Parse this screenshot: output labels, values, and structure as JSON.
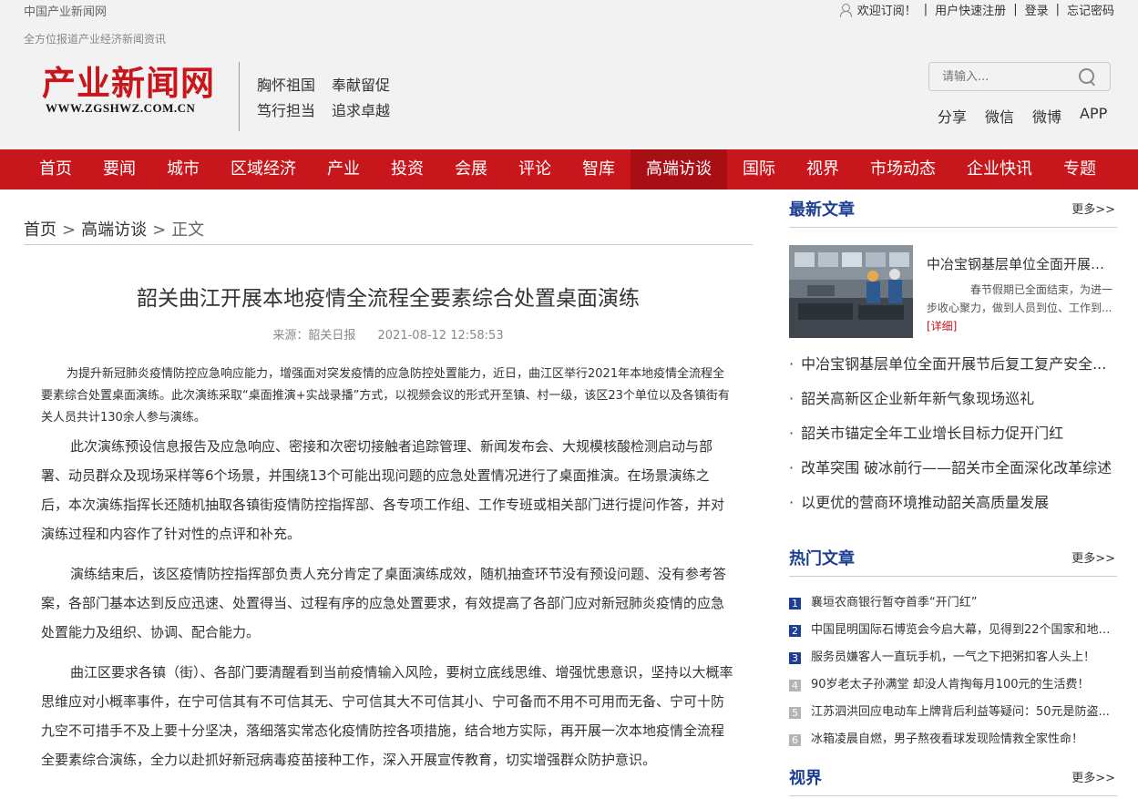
{
  "topbar": {
    "site_name": "中国产业新闻网",
    "subscribe": "欢迎订阅！",
    "register": "用户快速注册",
    "login": "登录",
    "forgot": "忘记密码"
  },
  "header": {
    "tagline": "全方位报道产业经济新闻资讯",
    "logo_cn": "产业新闻网",
    "logo_en": "WWW.ZGSHWZ.COM.CN",
    "slogan": [
      "胸怀祖国",
      "奉献留促",
      "笃行担当",
      "追求卓越"
    ],
    "search_placeholder": "请输入...",
    "share_links": [
      "分享",
      "微信",
      "微博",
      "APP"
    ]
  },
  "nav": {
    "items": [
      "首页",
      "要闻",
      "城市",
      "区域经济",
      "产业",
      "投资",
      "会展",
      "评论",
      "智库",
      "高端访谈",
      "国际",
      "视界",
      "市场动态",
      "企业快讯",
      "专题"
    ],
    "active": "高端访谈"
  },
  "breadcrumb": {
    "home": "首页",
    "section": "高端访谈",
    "current": "正文"
  },
  "article": {
    "title": "韶关曲江开展本地疫情全流程全要素综合处置桌面演练",
    "source": "来源：韶关日报",
    "datetime": "2021-08-12 12:58:53",
    "lead": "为提升新冠肺炎疫情防控应急响应能力，增强面对突发疫情的应急防控处置能力，近日，曲江区举行2021年本地疫情全流程全要素综合处置桌面演练。此次演练采取“桌面推演+实战录播”方式，以视频会议的形式开至镇、村一级，该区23个单位以及各镇街有关人员共计130余人参与演练。",
    "paragraphs": [
      "此次演练预设信息报告及应急响应、密接和次密切接触者追踪管理、新闻发布会、大规模核酸检测启动与部署、动员群众及现场采样等6个场景，并围绕13个可能出现问题的应急处置情况进行了桌面推演。在场景演练之后，本次演练指挥长还随机抽取各镇街疫情防控指挥部、各专项工作组、工作专班或相关部门进行提问作答，并对演练过程和内容作了针对性的点评和补充。",
      "演练结束后，该区疫情防控指挥部负责人充分肯定了桌面演练成效，随机抽查环节没有预设问题、没有参考答案，各部门基本达到反应迅速、处置得当、过程有序的应急处置要求，有效提高了各部门应对新冠肺炎疫情的应急处置能力及组织、协调、配合能力。",
      "曲江区要求各镇（街）、各部门要清醒看到当前疫情输入风险，要树立底线思维、增强忧患意识，坚持以大概率思维应对小概率事件，在宁可信其有不可信其无、宁可信其大不可信其小、宁可备而不用不可用而无备、宁可十防九空不可措手不及上要十分坚决，落细落实常态化疫情防控各项措施，结合地方实际，再开展一次本地疫情全流程全要素综合演练，全力以赴抓好新冠病毒疫苗接种工作，深入开展宣传教育，切实增强群众防护意识。"
    ]
  },
  "sidebar": {
    "latest": {
      "title": "最新文章",
      "more": "更多>>",
      "featured": {
        "title": "中冶宝钢基层单位全面开展节后复工复产安全...",
        "summary": "春节假期已全面结束，为进一步收心聚力，做到人员到位、工作到...",
        "detail": "[详细]"
      },
      "items": [
        "中冶宝钢基层单位全面开展节后复工复产安全...",
        "韶关高新区企业新年新气象现场巡礼",
        "韶关市锚定全年工业增长目标力促开门红",
        "改革突围 破冰前行——韶关市全面深化改革综述",
        "以更优的营商环境推动韶关高质量发展"
      ]
    },
    "hot": {
      "title": "热门文章",
      "more": "更多>>",
      "items": [
        {
          "num": "1",
          "text": "襄垣农商银行暂夺首季“开门红”"
        },
        {
          "num": "2",
          "text": "中国昆明国际石博览会今启大幕，见得到22个国家和地区..."
        },
        {
          "num": "3",
          "text": "服务员嫌客人一直玩手机，一气之下把粥扣客人头上！"
        },
        {
          "num": "4",
          "text": "90岁老太子孙满堂 却没人肯掏每月100元的生活费！"
        },
        {
          "num": "5",
          "text": "江苏泗洪回应电动车上牌背后利益等疑问：50元是防盗..."
        },
        {
          "num": "6",
          "text": "冰箱凌晨自燃，男子熬夜看球发现险情救全家性命！"
        }
      ]
    },
    "vision": {
      "title": "视界",
      "more": "更多>>"
    }
  }
}
